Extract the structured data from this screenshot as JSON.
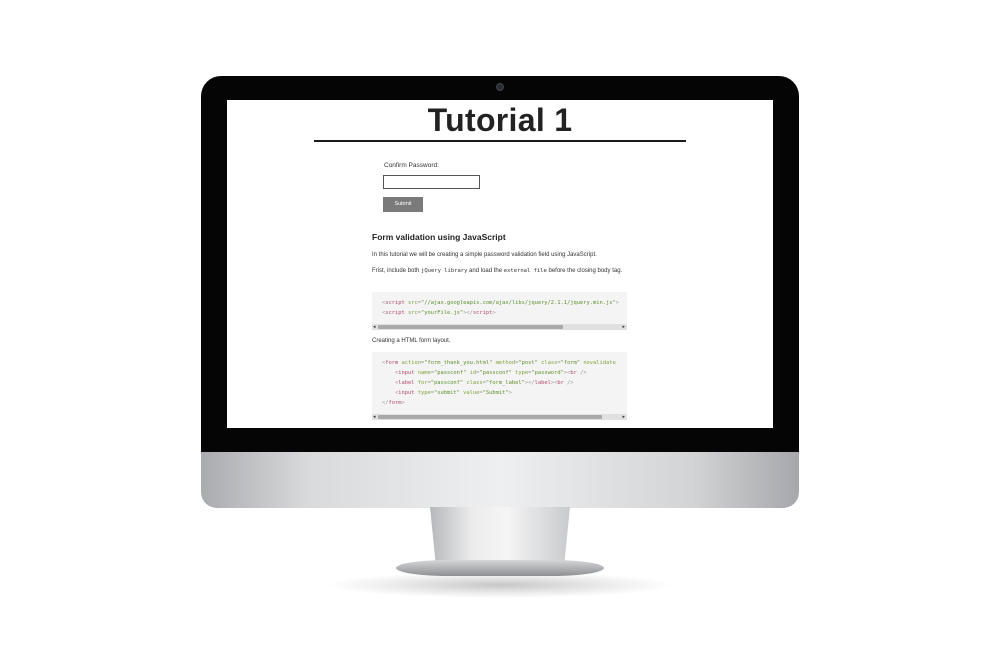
{
  "page": {
    "title": "Tutorial 1"
  },
  "form": {
    "confirm_label": "Confirm Password:",
    "input_value": "",
    "submit_label": "Submit"
  },
  "article": {
    "heading": "Form validation using JavaScript",
    "intro": "In this tutorial we will be creating a simple password validation field using JavaScript.",
    "include_prefix": "Frist, include both ",
    "include_code1": "jQuery library",
    "include_mid": " and load the ",
    "include_code2": "external file",
    "include_suffix": " before the closing body tag.",
    "layout_text": "Creating a HTML form layout."
  },
  "code_block_1": {
    "lines": [
      [
        {
          "t": "<",
          "c": "pn"
        },
        {
          "t": "script",
          "c": "tg"
        },
        {
          "t": " ",
          "c": "pn"
        },
        {
          "t": "src",
          "c": "at"
        },
        {
          "t": "=",
          "c": "pn"
        },
        {
          "t": "\"//ajax.googleapis.com/ajax/libs/jquery/2.1.1/jquery.min.js\"",
          "c": "st"
        },
        {
          "t": ">",
          "c": "pn"
        }
      ],
      [
        {
          "t": "<",
          "c": "pn"
        },
        {
          "t": "script",
          "c": "tg"
        },
        {
          "t": " ",
          "c": "pn"
        },
        {
          "t": "src",
          "c": "at"
        },
        {
          "t": "=",
          "c": "pn"
        },
        {
          "t": "\"yourFile.js\"",
          "c": "st"
        },
        {
          "t": "></",
          "c": "pn"
        },
        {
          "t": "script",
          "c": "tg"
        },
        {
          "t": ">",
          "c": "pn"
        }
      ]
    ],
    "scroll_fraction": 0.76
  },
  "code_block_2": {
    "lines": [
      [
        {
          "t": "<",
          "c": "pn"
        },
        {
          "t": "form",
          "c": "tg"
        },
        {
          "t": " ",
          "c": "pn"
        },
        {
          "t": "action",
          "c": "at"
        },
        {
          "t": "=",
          "c": "pn"
        },
        {
          "t": "\"form_thank_you.html\"",
          "c": "st"
        },
        {
          "t": " ",
          "c": "pn"
        },
        {
          "t": "method",
          "c": "at"
        },
        {
          "t": "=",
          "c": "pn"
        },
        {
          "t": "\"post\"",
          "c": "st"
        },
        {
          "t": " ",
          "c": "pn"
        },
        {
          "t": "class",
          "c": "at"
        },
        {
          "t": "=",
          "c": "pn"
        },
        {
          "t": "\"form\"",
          "c": "st"
        },
        {
          "t": " ",
          "c": "pn"
        },
        {
          "t": "novalidate",
          "c": "at"
        }
      ],
      [
        {
          "t": "    <",
          "c": "pn"
        },
        {
          "t": "input",
          "c": "tg"
        },
        {
          "t": " ",
          "c": "pn"
        },
        {
          "t": "name",
          "c": "at"
        },
        {
          "t": "=",
          "c": "pn"
        },
        {
          "t": "\"passconf\"",
          "c": "st"
        },
        {
          "t": " ",
          "c": "pn"
        },
        {
          "t": "id",
          "c": "at"
        },
        {
          "t": "=",
          "c": "pn"
        },
        {
          "t": "\"passconf\"",
          "c": "st"
        },
        {
          "t": " ",
          "c": "pn"
        },
        {
          "t": "type",
          "c": "at"
        },
        {
          "t": "=",
          "c": "pn"
        },
        {
          "t": "\"password\"",
          "c": "st"
        },
        {
          "t": "><",
          "c": "pn"
        },
        {
          "t": "br",
          "c": "tg"
        },
        {
          "t": " />",
          "c": "pn"
        }
      ],
      [
        {
          "t": "    <",
          "c": "pn"
        },
        {
          "t": "label",
          "c": "tg"
        },
        {
          "t": " ",
          "c": "pn"
        },
        {
          "t": "for",
          "c": "at"
        },
        {
          "t": "=",
          "c": "pn"
        },
        {
          "t": "\"passconf\"",
          "c": "st"
        },
        {
          "t": " ",
          "c": "pn"
        },
        {
          "t": "class",
          "c": "at"
        },
        {
          "t": "=",
          "c": "pn"
        },
        {
          "t": "\"form_label\"",
          "c": "st"
        },
        {
          "t": "></",
          "c": "pn"
        },
        {
          "t": "label",
          "c": "tg"
        },
        {
          "t": "><",
          "c": "pn"
        },
        {
          "t": "br",
          "c": "tg"
        },
        {
          "t": " />",
          "c": "pn"
        }
      ],
      [
        {
          "t": "    <",
          "c": "pn"
        },
        {
          "t": "input",
          "c": "tg"
        },
        {
          "t": " ",
          "c": "pn"
        },
        {
          "t": "type",
          "c": "at"
        },
        {
          "t": "=",
          "c": "pn"
        },
        {
          "t": "\"submit\"",
          "c": "st"
        },
        {
          "t": " ",
          "c": "pn"
        },
        {
          "t": "value",
          "c": "at"
        },
        {
          "t": "=",
          "c": "pn"
        },
        {
          "t": "\"Submit\"",
          "c": "st"
        },
        {
          "t": ">",
          "c": "pn"
        }
      ],
      [
        {
          "t": "</",
          "c": "pn"
        },
        {
          "t": "form",
          "c": "tg"
        },
        {
          "t": ">",
          "c": "pn"
        }
      ]
    ],
    "scroll_fraction": 0.92
  },
  "icons": {
    "scroll_left": "◂",
    "scroll_right": "▸"
  },
  "colors": {
    "monitor_bezel": "#050505",
    "submit_button": "#7a7a7a",
    "code_background": "#f4f4f4",
    "tag": "#b44a6a",
    "attribute": "#7ea23b",
    "string": "#5f8e2e"
  }
}
